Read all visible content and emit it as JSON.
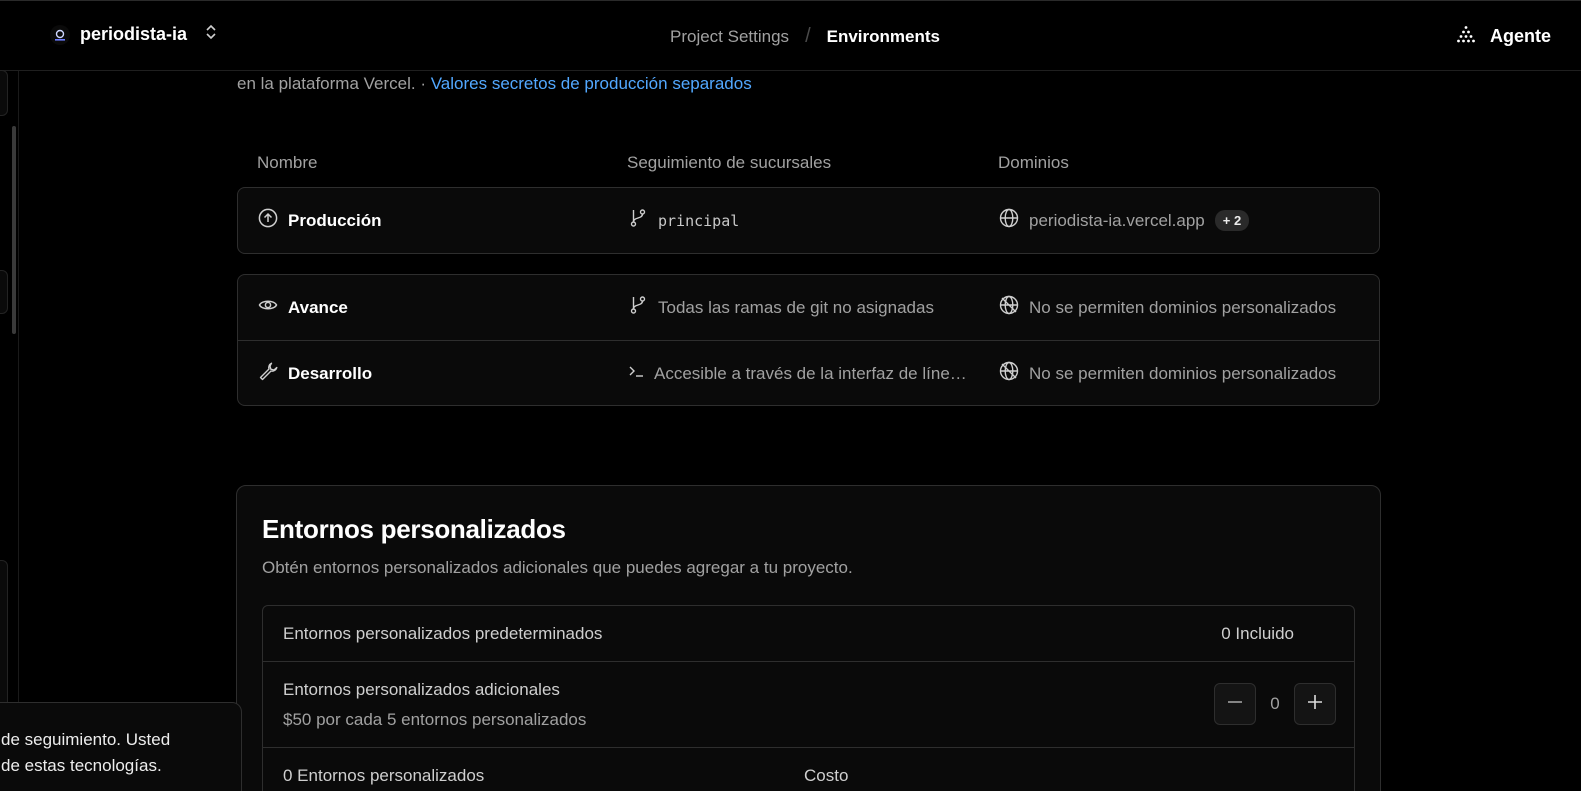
{
  "topbar": {
    "project_name": "periodista-ia",
    "breadcrumb_parent": "Project Settings",
    "breadcrumb_separator": "/",
    "breadcrumb_current": "Environments",
    "agent_label": "Agente"
  },
  "intro": {
    "text": "en la plataforma Vercel. · ",
    "link": "Valores secretos de producción separados"
  },
  "table": {
    "headers": {
      "name": "Nombre",
      "branch": "Seguimiento de sucursales",
      "domains": "Dominios"
    },
    "production": {
      "name": "Producción",
      "branch": "principal",
      "domain": "periodista-ia.vercel.app",
      "domain_badge": "+ 2"
    },
    "preview": {
      "name": "Avance",
      "branch": "Todas las ramas de git no asignadas",
      "domain": "No se permiten dominios personalizados"
    },
    "development": {
      "name": "Desarrollo",
      "branch": "Accesible a través de la interfaz de línea de comandos",
      "domain": "No se permiten dominios personalizados"
    }
  },
  "custom_envs": {
    "title": "Entornos personalizados",
    "description": "Obtén entornos personalizados adicionales que puedes agregar a tu proyecto.",
    "default_label": "Entornos personalizados predeterminados",
    "default_value": "0 Incluido",
    "additional_label": "Entornos personalizados adicionales",
    "additional_price": "$50 por cada 5 entornos personalizados",
    "additional_count": "0",
    "summary_label": "0 Entornos personalizados",
    "summary_cost_label": "Costo"
  },
  "toast": {
    "line1": "de seguimiento. Usted",
    "line2": "de estas tecnologías."
  },
  "colors": {
    "background": "#000000",
    "card": "#0a0a0a",
    "border": "#2e2e2e",
    "link": "#52a8ff",
    "muted": "#a1a1a1"
  }
}
